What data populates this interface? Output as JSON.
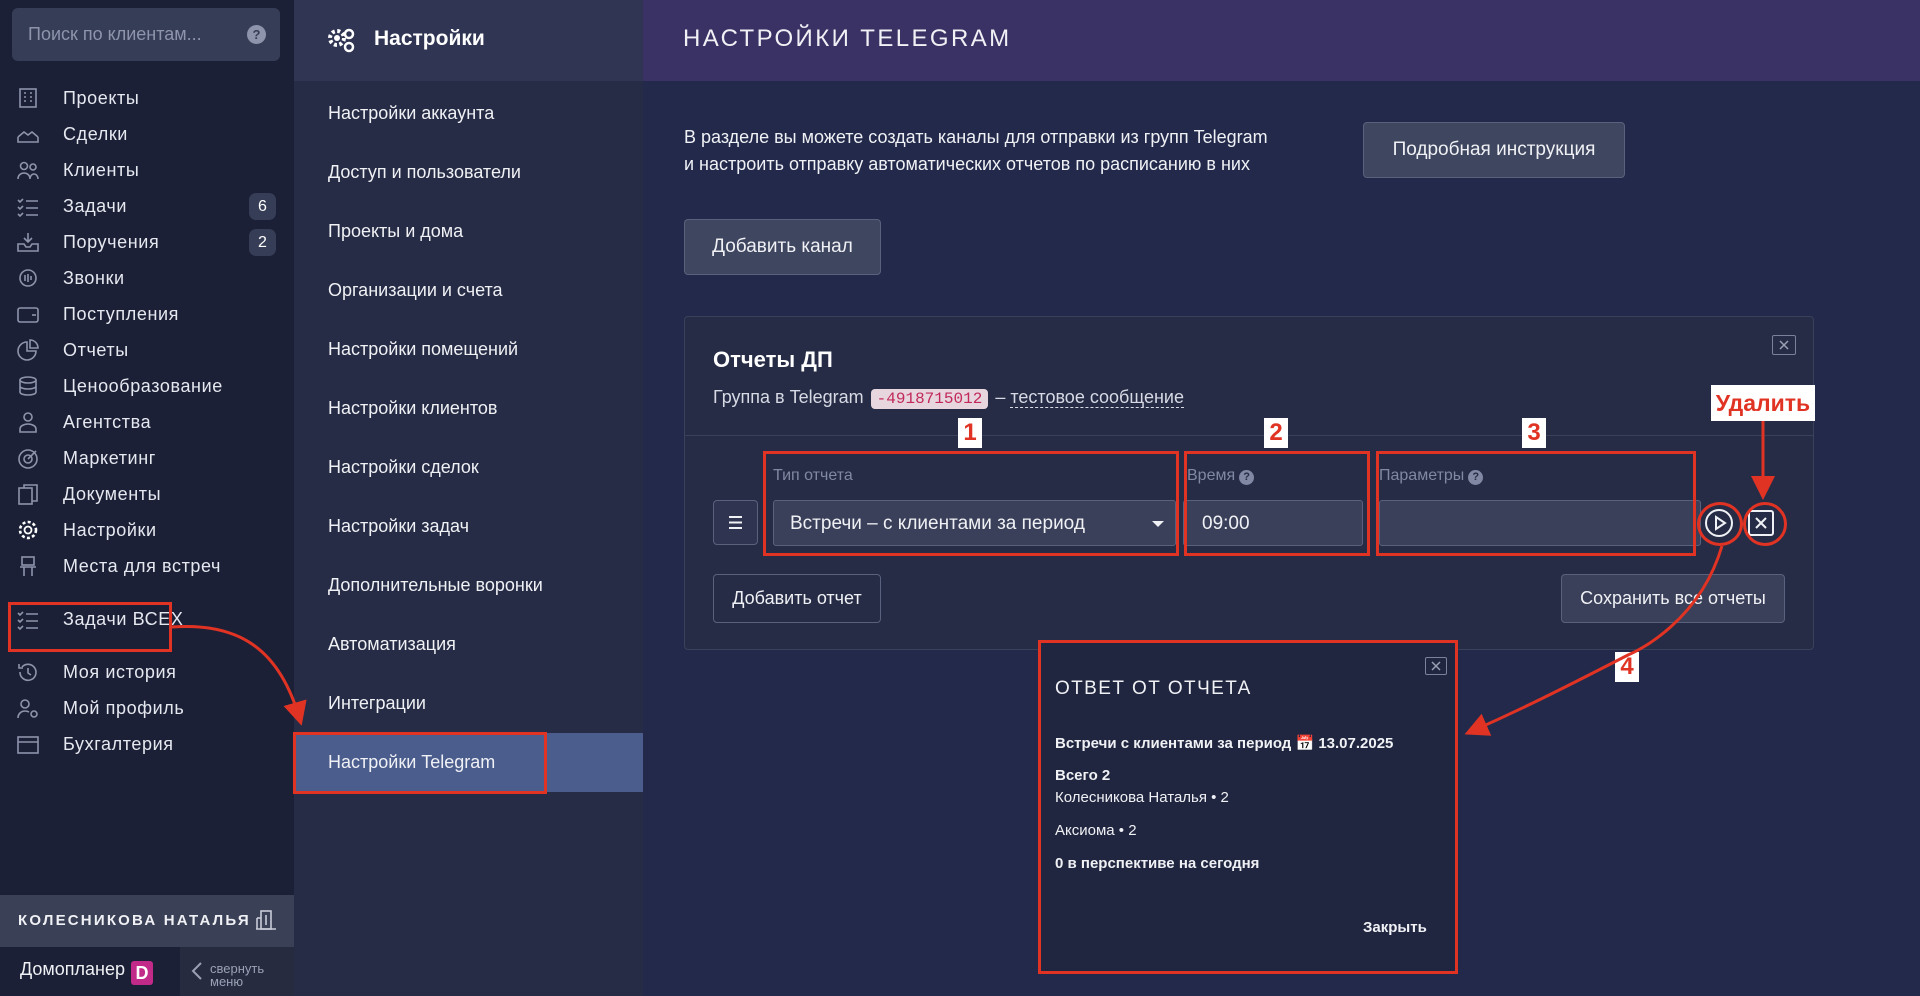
{
  "sidebar": {
    "search_placeholder": "Поиск по клиентам...",
    "items": [
      {
        "label": "Проекты",
        "icon": "building-icon"
      },
      {
        "label": "Сделки",
        "icon": "handshake-icon"
      },
      {
        "label": "Клиенты",
        "icon": "users-icon"
      },
      {
        "label": "Задачи",
        "icon": "tasks-icon",
        "badge": "6"
      },
      {
        "label": "Поручения",
        "icon": "inbox-icon",
        "badge": "2"
      },
      {
        "label": "Звонки",
        "icon": "phone-icon"
      },
      {
        "label": "Поступления",
        "icon": "wallet-icon"
      },
      {
        "label": "Отчеты",
        "icon": "pie-chart-icon"
      },
      {
        "label": "Ценообразование",
        "icon": "coins-icon"
      },
      {
        "label": "Агентства",
        "icon": "agent-icon"
      },
      {
        "label": "Маркетинг",
        "icon": "target-icon"
      },
      {
        "label": "Документы",
        "icon": "documents-icon"
      },
      {
        "label": "Настройки",
        "icon": "gear-icon"
      },
      {
        "label": "Места для встреч",
        "icon": "meeting-place-icon"
      },
      {
        "label": "Задачи ВСЕХ",
        "icon": "tasks-icon"
      },
      {
        "label": "Моя история",
        "icon": "history-icon"
      },
      {
        "label": "Мой профиль",
        "icon": "profile-icon"
      },
      {
        "label": "Бухгалтерия",
        "icon": "accounting-icon"
      }
    ],
    "user_name": "КОЛЕСНИКОВА НАТАЛЬЯ",
    "brand": "Домопланер",
    "brand_mark": "D",
    "collapse_line1": "свернуть",
    "collapse_line2": "меню"
  },
  "settings_menu": {
    "title": "Настройки",
    "items": [
      "Настройки аккаунта",
      "Доступ и пользователи",
      "Проекты и дома",
      "Организации и счета",
      "Настройки помещений",
      "Настройки клиентов",
      "Настройки сделок",
      "Настройки задач",
      "Дополнительные воронки",
      "Автоматизация",
      "Интеграции",
      "Настройки Telegram"
    ],
    "active_index": 11
  },
  "main": {
    "title": "НАСТРОЙКИ TELEGRAM",
    "intro_line1": "В разделе вы можете создать каналы для отправки из групп Telegram",
    "intro_line2": "и настроить отправку автоматических отчетов по расписанию в них",
    "guide_button": "Подробная инструкция",
    "add_channel_button": "Добавить канал",
    "card": {
      "title": "Отчеты ДП",
      "group_prefix": "Группа в Telegram",
      "chat_id": "-4918715012",
      "dash": "–",
      "test_link": "тестовое сообщение",
      "report_type_label": "Тип отчета",
      "report_type_value": "Встречи – с клиентами за период",
      "time_label": "Время",
      "time_value": "09:00",
      "params_label": "Параметры",
      "params_value": "",
      "add_report_button": "Добавить отчет",
      "save_all_button": "Сохранить все отчеты"
    }
  },
  "popup": {
    "title": "ОТВЕТ ОТ ОТЧЕТА",
    "line1": "Встречи с клиентами за период 📅 13.07.2025",
    "line2": "Всего 2",
    "line3": "Колесникова Наталья • 2",
    "line4": "Аксиома • 2",
    "line5": "0 в перспективе на сегодня",
    "close": "Закрыть"
  },
  "annotations": {
    "n1": "1",
    "n2": "2",
    "n3": "3",
    "n4": "4",
    "delete": "Удалить"
  },
  "colors": {
    "annotation_red": "#e03323",
    "sidebar_bg": "#1b2036",
    "active_menu": "#4b5d8d",
    "header_purple": "#3a3164"
  }
}
